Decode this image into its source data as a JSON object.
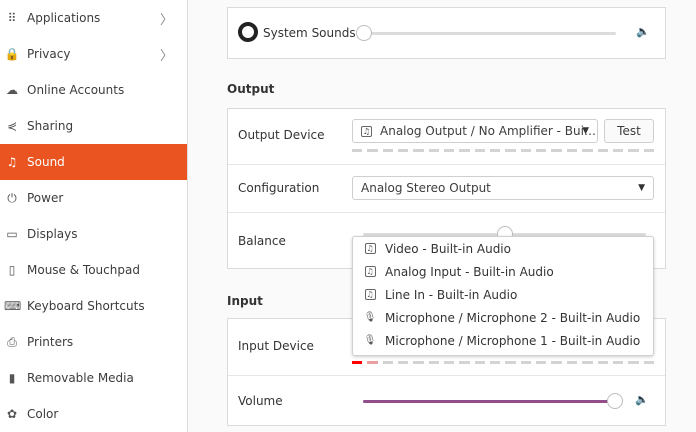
{
  "sidebar": {
    "items": [
      {
        "label": "Applications",
        "icon": "grid-icon",
        "chevron": true
      },
      {
        "label": "Privacy",
        "icon": "lock-icon",
        "chevron": true
      },
      {
        "label": "Online Accounts",
        "icon": "cloud-icon"
      },
      {
        "label": "Sharing",
        "icon": "share-icon"
      },
      {
        "label": "Sound",
        "icon": "music-note-icon",
        "active": true
      },
      {
        "label": "Power",
        "icon": "power-icon"
      },
      {
        "label": "Displays",
        "icon": "display-icon"
      },
      {
        "label": "Mouse & Touchpad",
        "icon": "mouse-icon"
      },
      {
        "label": "Keyboard Shortcuts",
        "icon": "keyboard-icon"
      },
      {
        "label": "Printers",
        "icon": "printer-icon"
      },
      {
        "label": "Removable Media",
        "icon": "media-icon"
      },
      {
        "label": "Color",
        "icon": "color-icon"
      }
    ],
    "accent": "#e95420"
  },
  "system_sounds": {
    "label": "System Sounds",
    "volume_percent": 0
  },
  "output": {
    "heading": "Output",
    "device_label": "Output Device",
    "device_value": "Analog Output / No Amplifier - Bui…",
    "test_label": "Test",
    "configuration_label": "Configuration",
    "configuration_value": "Analog Stereo Output",
    "balance_label": "Balance",
    "balance_percent": 50
  },
  "popup": {
    "items": [
      {
        "label": "Video - Built-in Audio",
        "icon": "audio-card-icon"
      },
      {
        "label": "Analog Input - Built-in Audio",
        "icon": "audio-card-icon"
      },
      {
        "label": "Line In - Built-in Audio",
        "icon": "audio-card-icon"
      },
      {
        "label": "Microphone / Microphone 2 - Built-in Audio",
        "icon": "microphone-icon"
      },
      {
        "label": "Microphone / Microphone 1 - Built-in Audio",
        "icon": "microphone-icon"
      }
    ]
  },
  "input": {
    "heading": "Input",
    "device_label": "Input Device",
    "volume_label": "Volume",
    "volume_percent": 100,
    "volume_color": "#924d8b",
    "level_color": "#ff0000"
  }
}
